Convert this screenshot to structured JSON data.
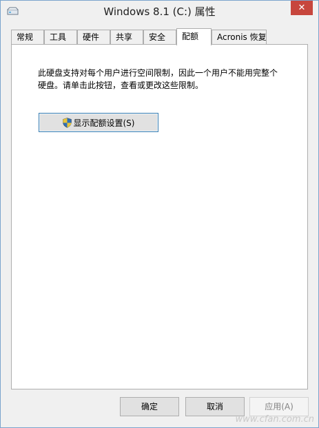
{
  "window": {
    "title": "Windows 8.1 (C:) 属性",
    "close_glyph": "✕"
  },
  "tabs": [
    {
      "label": "常规"
    },
    {
      "label": "工具"
    },
    {
      "label": "硬件"
    },
    {
      "label": "共享"
    },
    {
      "label": "安全"
    },
    {
      "label": "配额",
      "active": true
    },
    {
      "label": "Acronis 恢复"
    }
  ],
  "quota": {
    "description": "此硬盘支持对每个用户进行空间限制，因此一个用户不能用完整个硬盘。请单击此按钮，查看或更改这些限制。",
    "show_settings_label": "显示配额设置(S)"
  },
  "footer": {
    "ok_label": "确定",
    "cancel_label": "取消",
    "apply_label": "应用(A)"
  },
  "watermark": "www.cfan.com.cn",
  "colors": {
    "close_button": "#c7463d",
    "button_focus_border": "#3c7fb1",
    "panel_bg": "#ffffff",
    "window_bg": "#f0f0f0"
  }
}
